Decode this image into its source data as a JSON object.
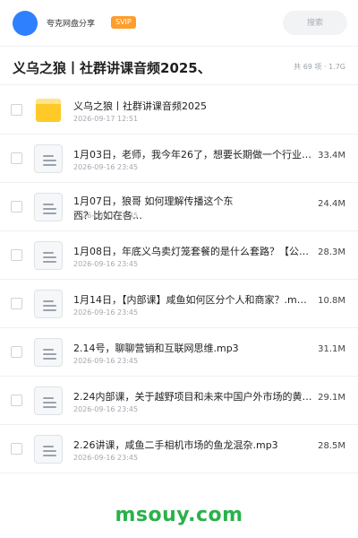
{
  "header": {
    "brand": "夸克网盘分享",
    "badge": "SVIP",
    "search_placeholder": "搜索"
  },
  "folder": {
    "title": "义乌之狼丨社群讲课音频2025、",
    "summary": "共 69 项 · 1.7G"
  },
  "files": [
    {
      "type": "folder",
      "name": "义乌之狼丨社群讲课音频2025",
      "date": "2026-09-17 12:51",
      "size": ""
    },
    {
      "type": "file",
      "name": "1月03日，老师，我今年26了，想要长期做一个行业…",
      "date": "2026-09-16 23:45",
      "size": "33.4M"
    },
    {
      "type": "file",
      "name": "1月07日，狼哥 如何理解传播这个东西？比如在各…",
      "date": "2026-09-16 23:45",
      "size": "24.4M"
    },
    {
      "type": "file",
      "name": "1月08日，年底义乌卖灯笼套餐的是什么套路？【公重…",
      "date": "2026-09-16 23:45",
      "size": "28.3M"
    },
    {
      "type": "file",
      "name": "1月14日，【内部课】咸鱼如何区分个人和商家？.m…",
      "date": "2026-09-16 23:45",
      "size": "10.8M"
    },
    {
      "type": "file",
      "name": "2.14号，聊聊营销和互联网思维.mp3",
      "date": "2026-09-16 23:45",
      "size": "31.1M"
    },
    {
      "type": "file",
      "name": "2.24内部课，关于越野项目和未来中国户外市场的黄…",
      "date": "2026-09-16 23:45",
      "size": "29.1M"
    },
    {
      "type": "file",
      "name": "2.26讲课，咸鱼二手相机市场的鱼龙混杂.mp3",
      "date": "2026-09-16 23:45",
      "size": "28.5M"
    }
  ],
  "watermark": "msouy.com",
  "colors": {
    "accent": "#2f80ff",
    "badge": "#ff9e2c",
    "folder": "#ffc928",
    "watermark": "#29b24a"
  }
}
